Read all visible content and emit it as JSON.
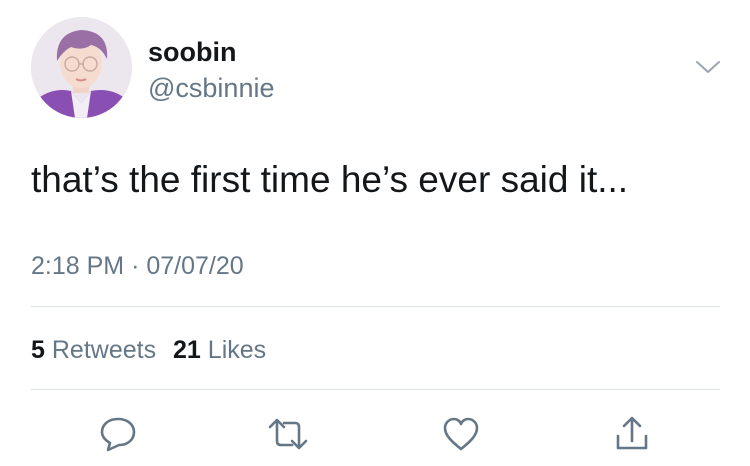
{
  "author": {
    "display_name": "soobin",
    "handle": "@csbinnie"
  },
  "tweet": {
    "text": "that’s the first time he’s ever said it...",
    "time": "2:18 PM",
    "separator": "·",
    "date": "07/07/20"
  },
  "stats": {
    "retweets_count": "5",
    "retweets_label": "Retweets",
    "likes_count": "21",
    "likes_label": "Likes"
  },
  "icons": {
    "menu": "chevron-down-icon",
    "reply": "reply-icon",
    "retweet": "retweet-icon",
    "like": "heart-icon",
    "share": "share-icon"
  },
  "colors": {
    "text_primary": "#14171a",
    "text_secondary": "#657786",
    "divider": "#d9dfe4",
    "icon": "#657786"
  }
}
